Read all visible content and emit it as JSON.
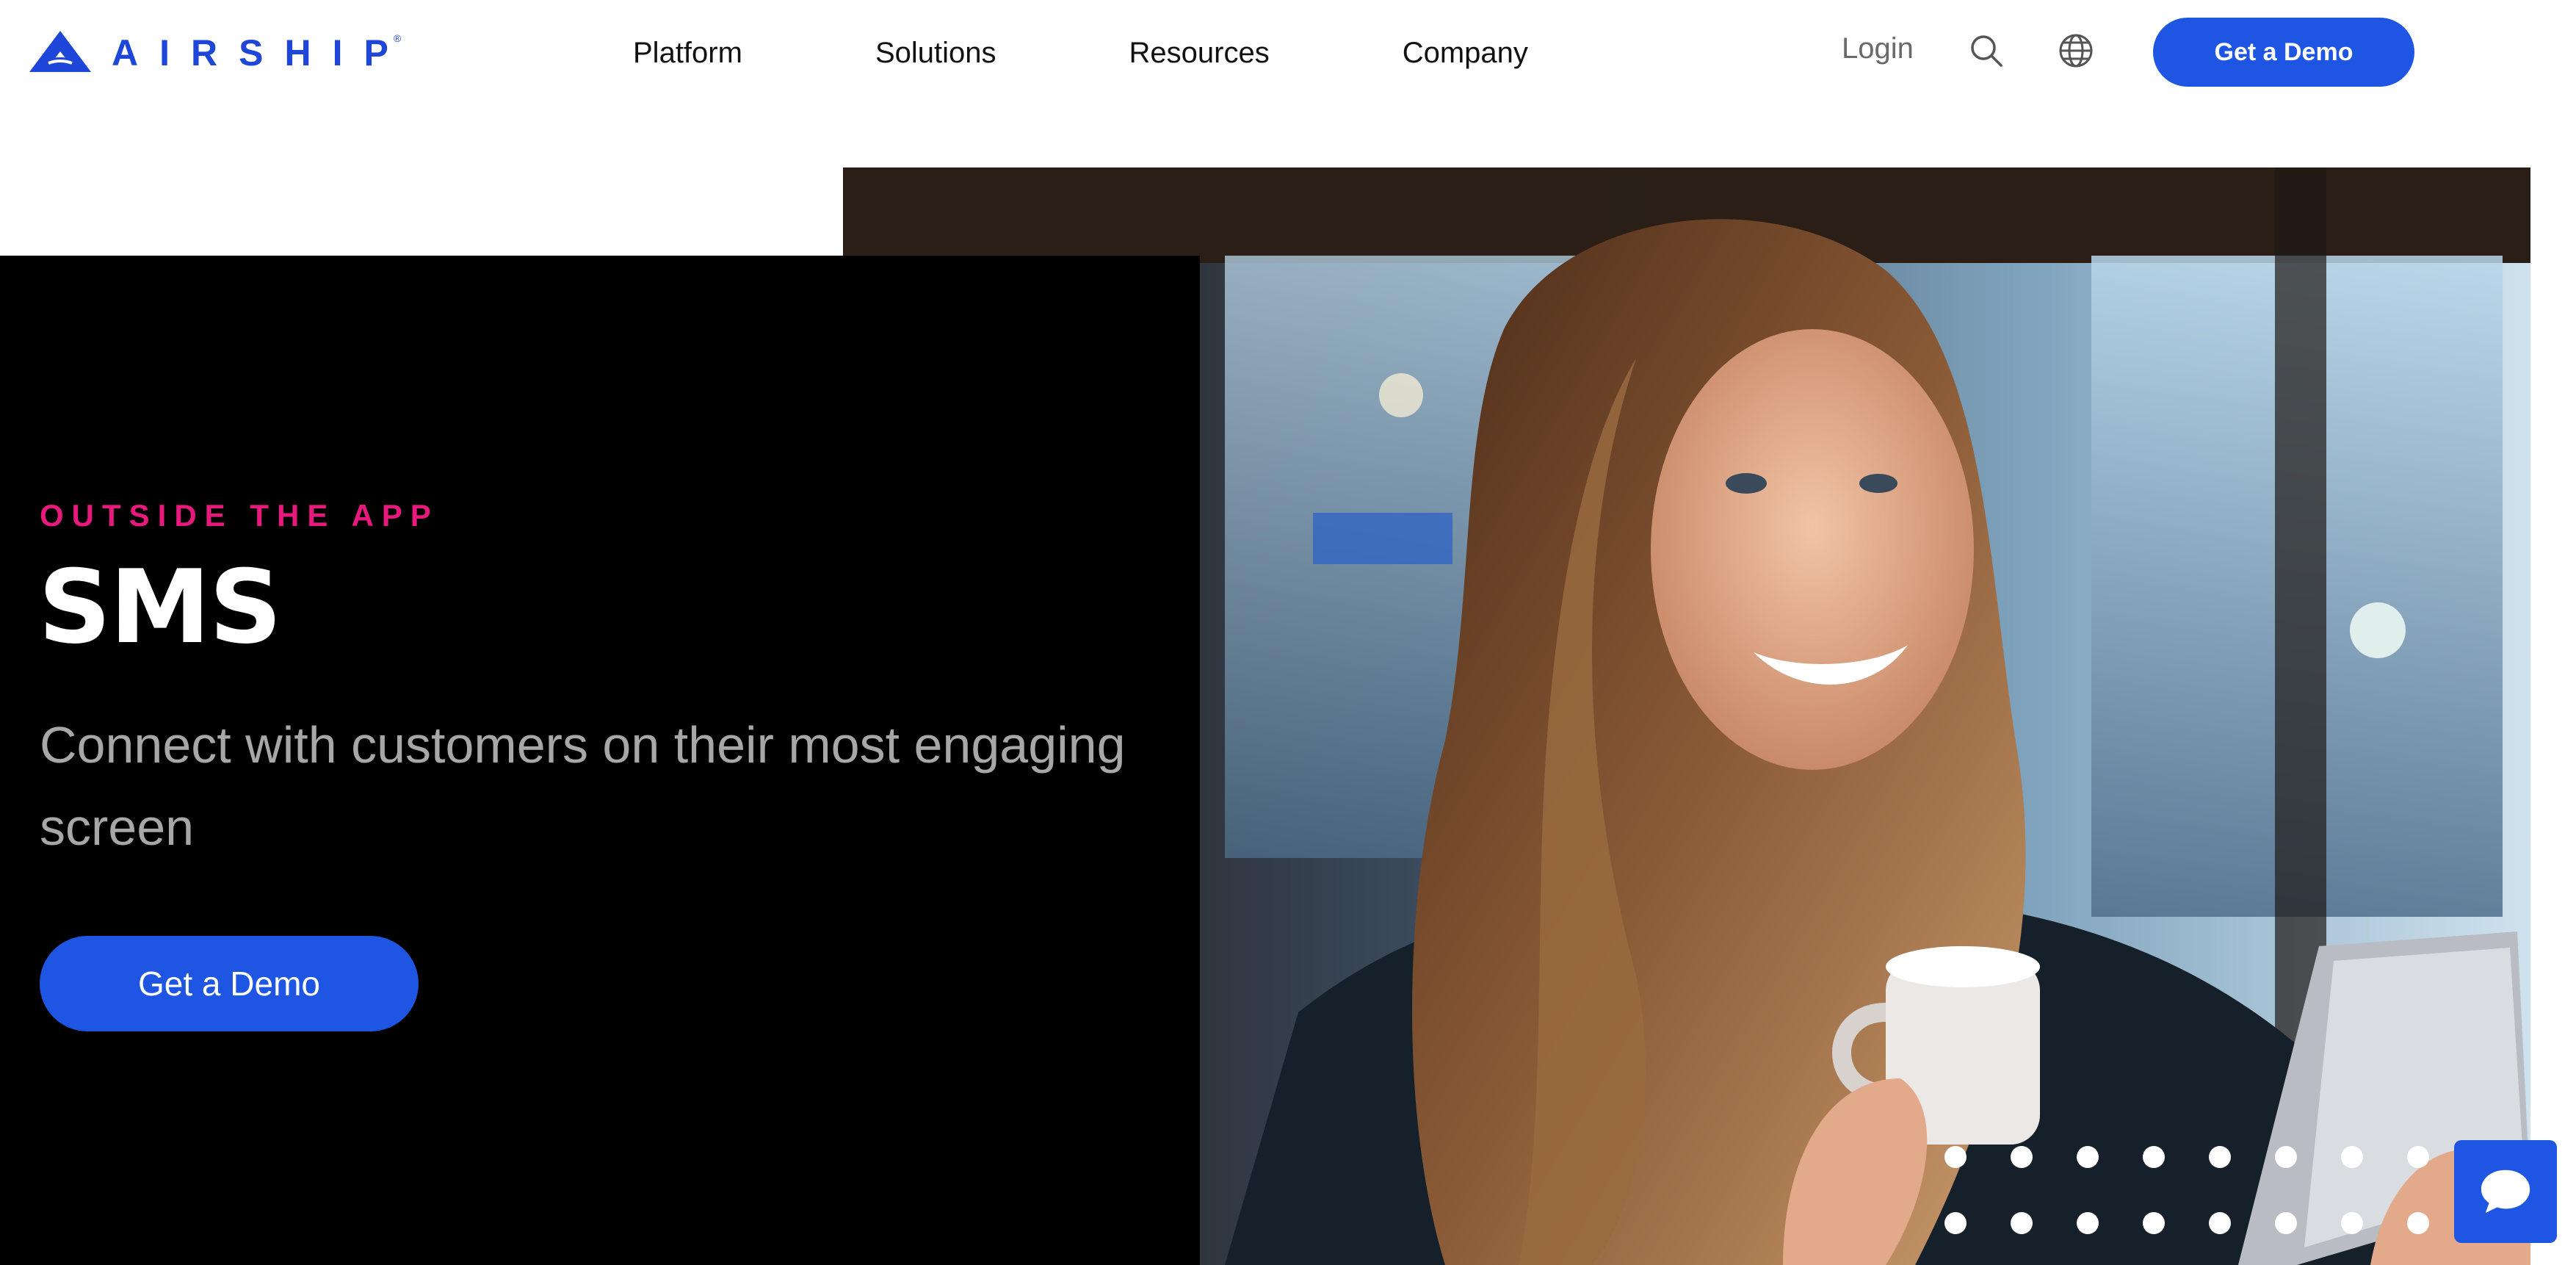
{
  "header": {
    "logo_text": "AIRSHIP",
    "logo_reg": "®",
    "nav": [
      "Platform",
      "Solutions",
      "Resources",
      "Company"
    ],
    "login_label": "Login",
    "search_icon": "search-icon",
    "language_icon": "globe-icon",
    "cta_label": "Get a Demo"
  },
  "hero": {
    "eyebrow": "OUTSIDE THE APP",
    "title": "SMS",
    "subtitle": "Connect with customers on their most engaging screen",
    "cta_label": "Get a Demo",
    "image_description_icon": "photo-woman-phone-coffee"
  },
  "chat": {
    "icon": "chat-bubble-icon"
  },
  "colors": {
    "brand_blue": "#1e55e2",
    "logo_blue": "#1e47d9",
    "eyebrow_pink": "#e8197d",
    "panel_black": "#000000",
    "subtitle_gray": "#a7a7a7"
  }
}
